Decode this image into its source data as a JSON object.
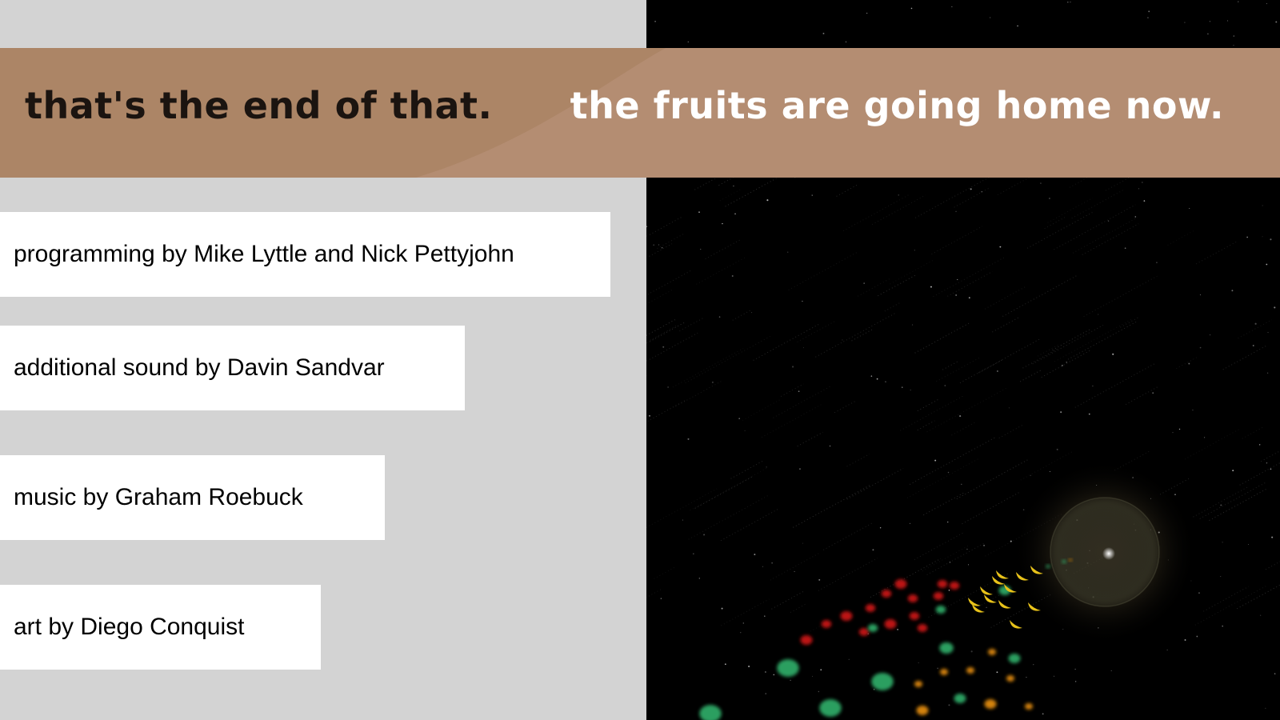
{
  "banner": {
    "left_text": "that's the end of that.",
    "right_text": "the fruits are going home now.",
    "color": "#b48d72"
  },
  "credits": [
    "programming by Mike Lyttle and Nick Pettyjohn",
    "additional sound by Davin Sandvar",
    "music by Graham Roebuck",
    "art by Diego Conquist"
  ],
  "colors": {
    "left_background": "#d3d3d3",
    "space_background": "#000000",
    "fruit_red": "#c81414",
    "fruit_green": "#2fa866",
    "fruit_yellow": "#e8c21a",
    "fruit_orange": "#e08a10"
  }
}
